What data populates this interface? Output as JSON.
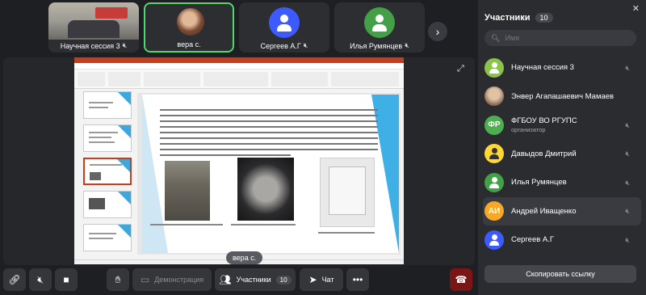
{
  "tiles": [
    {
      "name": "Научная сессия 3",
      "muted": true
    },
    {
      "name": "вера с.",
      "muted": false,
      "active": true
    },
    {
      "name": "Сергеев А.Г",
      "muted": true
    },
    {
      "name": "Илья Румянцев",
      "muted": true
    }
  ],
  "stage": {
    "speaker_label": "вера с."
  },
  "panel": {
    "title": "Участники",
    "count": "10",
    "search_placeholder": "Имя",
    "participants": [
      {
        "name": "Научная сессия 3",
        "role": "",
        "initials": "",
        "avatar_color": "#8bc34a"
      },
      {
        "name": "Энвер Агапашаевич Мамаев",
        "role": "",
        "initials": "",
        "avatar_color": "#c9a584"
      },
      {
        "name": "ФГБОУ ВО РГУПС",
        "role": "организатор",
        "initials": "ФР",
        "avatar_color": "#4caf50"
      },
      {
        "name": "Давыдов Дмитрий",
        "role": "",
        "initials": "",
        "avatar_color": "#fdd835"
      },
      {
        "name": "Илья Румянцев",
        "role": "",
        "initials": "",
        "avatar_color": "#43a047"
      },
      {
        "name": "Андрей Иващенко",
        "role": "",
        "initials": "АИ",
        "avatar_color": "#f9a825"
      },
      {
        "name": "Сергеев А.Г",
        "role": "",
        "initials": "",
        "avatar_color": "#3d5afe"
      }
    ],
    "copy_link_label": "Скопировать ссылку"
  },
  "toolbar": {
    "demo_label": "Демонстрация",
    "participants_label": "Участники",
    "participants_count": "10",
    "chat_label": "Чат"
  },
  "colors": {
    "active_border": "#4fd86b",
    "end_call": "#7a1616",
    "accent_blue": "#3d5afe"
  }
}
